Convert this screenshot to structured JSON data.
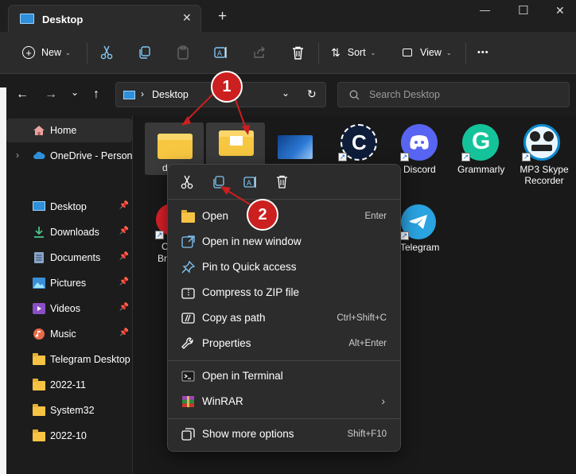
{
  "window": {
    "tab_title": "Desktop",
    "new_tab": "+",
    "minimize": "—",
    "maximize": "☐",
    "close": "✕"
  },
  "toolbar": {
    "new_label": "New",
    "sort_label": "Sort",
    "view_label": "View",
    "more_label": "•••"
  },
  "address": {
    "breadcrumb": "Desktop",
    "search_placeholder": "Search Desktop"
  },
  "sidebar": {
    "items": [
      {
        "label": "Home"
      },
      {
        "label": "OneDrive - Persona"
      },
      {
        "label": "Desktop"
      },
      {
        "label": "Downloads"
      },
      {
        "label": "Documents"
      },
      {
        "label": "Pictures"
      },
      {
        "label": "Videos"
      },
      {
        "label": "Music"
      },
      {
        "label": "Telegram Desktop"
      },
      {
        "label": "2022-11"
      },
      {
        "label": "System32"
      },
      {
        "label": "2022-10"
      }
    ]
  },
  "desktop_items": [
    {
      "label": "Discord"
    },
    {
      "label": "Grammarly"
    },
    {
      "label": "MP3 Skype Recorder"
    },
    {
      "label": "Telegram"
    },
    {
      "label": "d"
    },
    {
      "label": "C"
    },
    {
      "label": "Br"
    }
  ],
  "context_menu": {
    "items": [
      {
        "label": "Open",
        "shortcut": "Enter"
      },
      {
        "label": "Open in new window",
        "shortcut": ""
      },
      {
        "label": "Pin to Quick access",
        "shortcut": ""
      },
      {
        "label": "Compress to ZIP file",
        "shortcut": ""
      },
      {
        "label": "Copy as path",
        "shortcut": "Ctrl+Shift+C"
      },
      {
        "label": "Properties",
        "shortcut": "Alt+Enter"
      },
      {
        "label": "Open in Terminal",
        "shortcut": ""
      },
      {
        "label": "WinRAR",
        "shortcut": ""
      },
      {
        "label": "Show more options",
        "shortcut": "Shift+F10"
      }
    ]
  },
  "annotations": {
    "badge1": "1",
    "badge2": "2"
  },
  "colors": {
    "accent": "#60cdff",
    "annotation_red": "#cc1f1f",
    "folder_yellow": "#f6c344"
  }
}
